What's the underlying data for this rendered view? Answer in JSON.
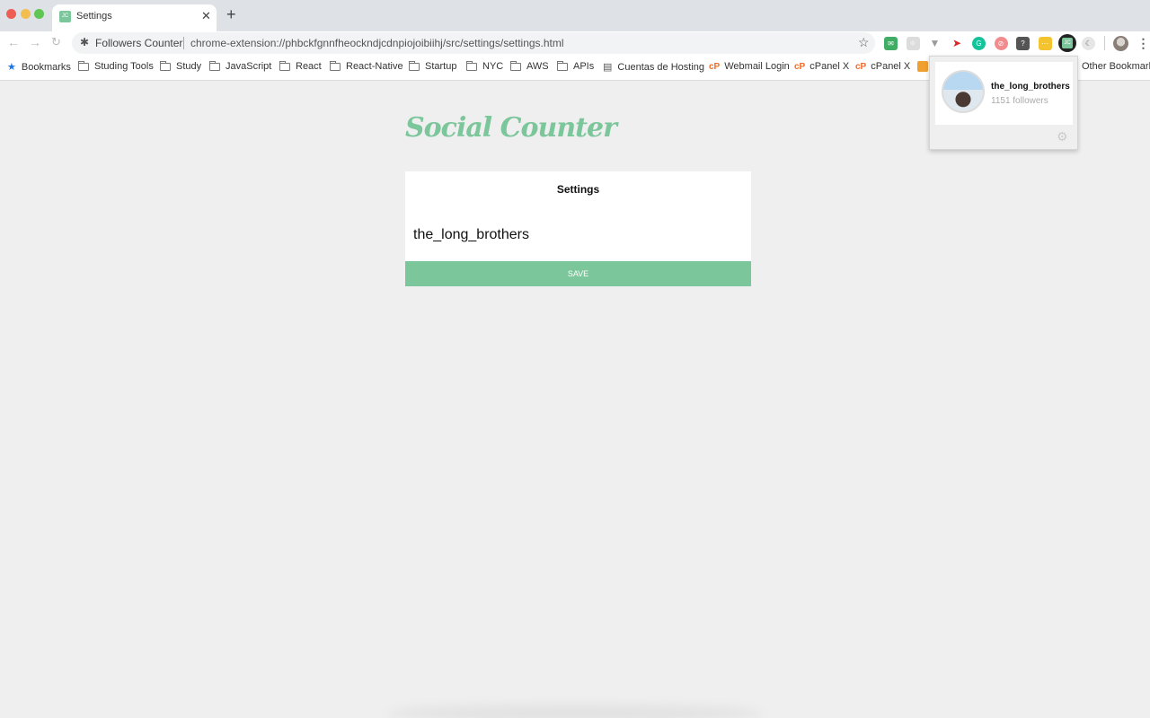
{
  "browser": {
    "tab": {
      "title": "Settings",
      "favicon_text": "JC"
    },
    "omnibox": {
      "extension_label": "Followers Counter",
      "url": "chrome-extension://phbckfgnnfheockndjcdnpiojoibiihj/src/settings/settings.html"
    },
    "extensions": [
      {
        "name": "inbox-extension-icon",
        "color": "#3fae64"
      },
      {
        "name": "react-devtools-icon",
        "color": "#dcdcdc"
      },
      {
        "name": "vue-devtools-icon",
        "color": "#9a9a9a"
      },
      {
        "name": "bird-extension-icon",
        "color": "#d8262c"
      },
      {
        "name": "grammarly-icon",
        "color": "#15c39a"
      },
      {
        "name": "blocker-extension-icon",
        "color": "#f28b8b"
      },
      {
        "name": "lightbulb-extension-icon",
        "color": "#555555"
      },
      {
        "name": "dots-extension-icon",
        "color": "#f4c430"
      },
      {
        "name": "dark-mode-icon",
        "color": "#cccccc"
      }
    ],
    "active_extension_text": "JC",
    "bookmarks": [
      {
        "label": "Bookmarks",
        "icon": "star"
      },
      {
        "label": "Studing Tools",
        "icon": "folder"
      },
      {
        "label": "Study",
        "icon": "folder"
      },
      {
        "label": "JavaScript",
        "icon": "folder"
      },
      {
        "label": "React",
        "icon": "folder"
      },
      {
        "label": "React-Native",
        "icon": "folder"
      },
      {
        "label": "Startup",
        "icon": "folder"
      },
      {
        "label": "NYC",
        "icon": "folder"
      },
      {
        "label": "AWS",
        "icon": "folder"
      },
      {
        "label": "APIs",
        "icon": "folder"
      },
      {
        "label": "Cuentas de Hosting",
        "icon": "document"
      },
      {
        "label": "Webmail Login",
        "icon": "cpanel"
      },
      {
        "label": "cPanel X",
        "icon": "cpanel"
      },
      {
        "label": "cPanel X",
        "icon": "cpanel"
      }
    ],
    "other_bookmarks": "Other Bookmarks"
  },
  "popup": {
    "username": "the_long_brothers",
    "followers": "1151 followers"
  },
  "page": {
    "logo": "Social Counter",
    "card_title": "Settings",
    "username_value": "the_long_brothers",
    "save_label": "SAVE",
    "accent_color": "#7bc69a"
  }
}
